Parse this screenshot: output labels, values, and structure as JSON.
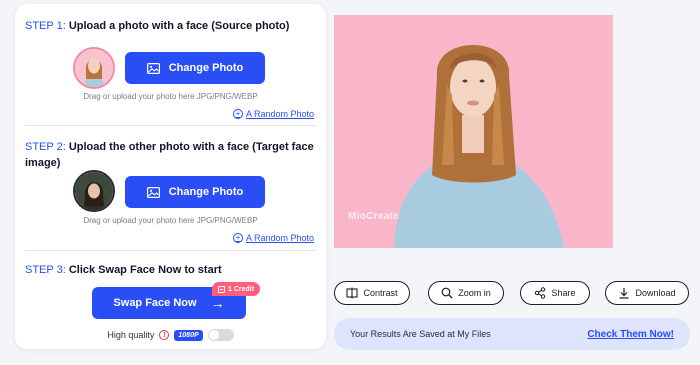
{
  "steps": [
    {
      "num": "STEP 1:",
      "title": "Upload a photo with a face (Source photo)"
    },
    {
      "num": "STEP 2:",
      "title": "Upload the other photo with a face (Target face",
      "title_line2": "image)"
    },
    {
      "num": "STEP 3:",
      "title": "Click Swap Face Now to start"
    }
  ],
  "upload": {
    "change_label": "Change Photo",
    "hint": "Drag or upload your photo here JPG/PNG/WEBP",
    "random_label": "A Random Photo"
  },
  "swap": {
    "label": "Swap Face Now",
    "arrow": "→",
    "credit_label": "1 Credit"
  },
  "quality": {
    "label": "High quality",
    "info": "!",
    "badge": "1080P",
    "enabled": false
  },
  "result": {
    "watermark": "MioCreate"
  },
  "actions": [
    {
      "label": "Contrast",
      "icon": "compare-icon"
    },
    {
      "label": "Zoom in",
      "icon": "search-icon"
    },
    {
      "label": "Share",
      "icon": "share-icon"
    },
    {
      "label": "Download",
      "icon": "download-icon"
    }
  ],
  "save_bar": {
    "text": "Your Results Are Saved at My Files",
    "link": "Check Them Now!"
  },
  "colors": {
    "accent": "#2a4ef5",
    "badge": "#ff5f7a",
    "image_background": "#f8b6c8",
    "save_bar": "#dde4fc"
  }
}
